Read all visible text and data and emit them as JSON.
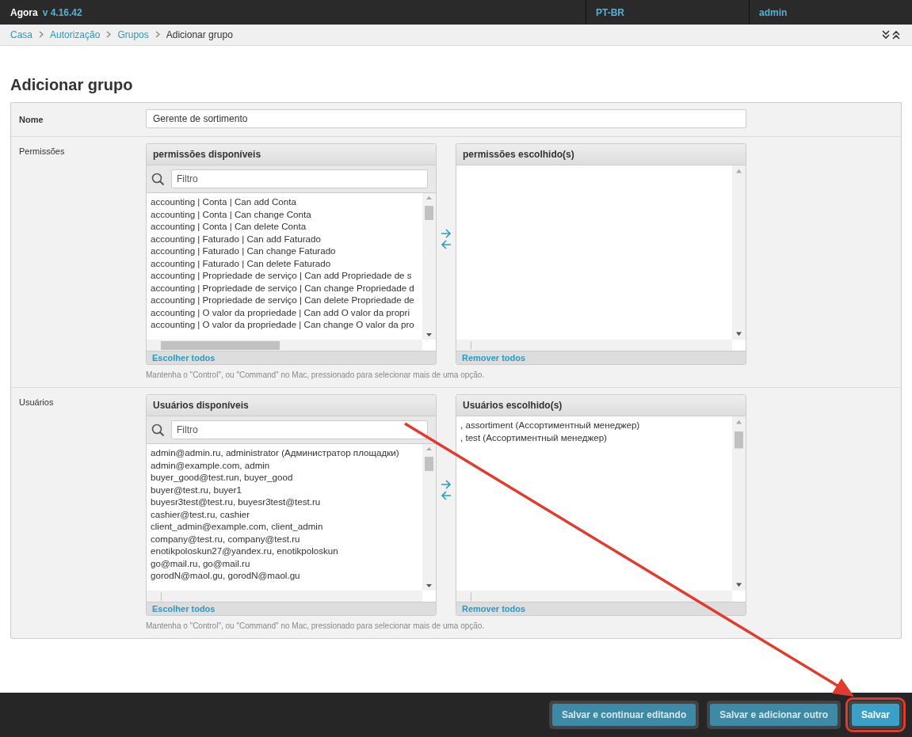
{
  "header": {
    "brand": "Agora",
    "version": "v 4.16.42",
    "language": "PT-BR",
    "user": "admin"
  },
  "breadcrumbs": [
    {
      "label": "Casa",
      "current": false
    },
    {
      "label": "Autorização",
      "current": false
    },
    {
      "label": "Grupos",
      "current": false
    },
    {
      "label": "Adicionar grupo",
      "current": true
    }
  ],
  "page_title": "Adicionar grupo",
  "form": {
    "name_field": {
      "label": "Nome",
      "value": "Gerente de sortimento"
    },
    "selectors": [
      {
        "label": "Permissões",
        "available": {
          "title": "permissões disponíveis",
          "filter_placeholder": "Filtro",
          "items": [
            "accounting | Conta | Can add Conta",
            "accounting | Conta | Can change Conta",
            "accounting | Conta | Can delete Conta",
            "accounting | Faturado | Can add Faturado",
            "accounting | Faturado | Can change Faturado",
            "accounting | Faturado | Can delete Faturado",
            "accounting | Propriedade de serviço | Can add Propriedade de s",
            "accounting | Propriedade de serviço | Can change Propriedade d",
            "accounting | Propriedade de serviço | Can delete Propriedade de",
            "accounting | O valor da propriedade | Can add O valor da propri",
            "accounting | O valor da propriedade | Can change O valor da pro"
          ],
          "action": "Escolher todos"
        },
        "chosen": {
          "title": "permissões escolhido(s)",
          "action": "Remover todos"
        },
        "help": "Mantenha o \"Control\", ou \"Command\" no Mac, pressionado para selecionar mais de uma opção."
      },
      {
        "label": "Usuários",
        "available": {
          "title": "Usuários disponíveis",
          "filter_placeholder": "Filtro",
          "items": [
            "admin@admin.ru, administrator (Администратор площадки)",
            "admin@example.com, admin",
            "buyer_good@test.run, buyer_good",
            "buyer@test.ru, buyer1",
            "buyesr3test@test.ru, buyesr3test@test.ru",
            "cashier@test.ru, cashier",
            "client_admin@example.com, client_admin",
            "company@test.ru, company@test.ru",
            "enotikpoloskun27@yandex.ru, enotikpoloskun",
            "go@mail.ru, go@mail.ru",
            "gorodN@maol.gu, gorodN@maol.gu"
          ],
          "action": "Escolher todos"
        },
        "chosen": {
          "title": "Usuários escolhido(s)",
          "items": [
            ", assortiment (Ассортиментный менеджер)",
            ", test (Ассортиментный менеджер)"
          ],
          "action": "Remover todos"
        },
        "help": "Mantenha o \"Control\", ou \"Command\" no Mac, pressionado para selecionar mais de uma opção."
      }
    ]
  },
  "buttons": [
    {
      "label": "Salvar e continuar editando",
      "primary": false,
      "highlighted": false
    },
    {
      "label": "Salvar e adicionar outro",
      "primary": false,
      "highlighted": false
    },
    {
      "label": "Salvar",
      "primary": true,
      "highlighted": true
    }
  ],
  "annotation_arrow": true
}
